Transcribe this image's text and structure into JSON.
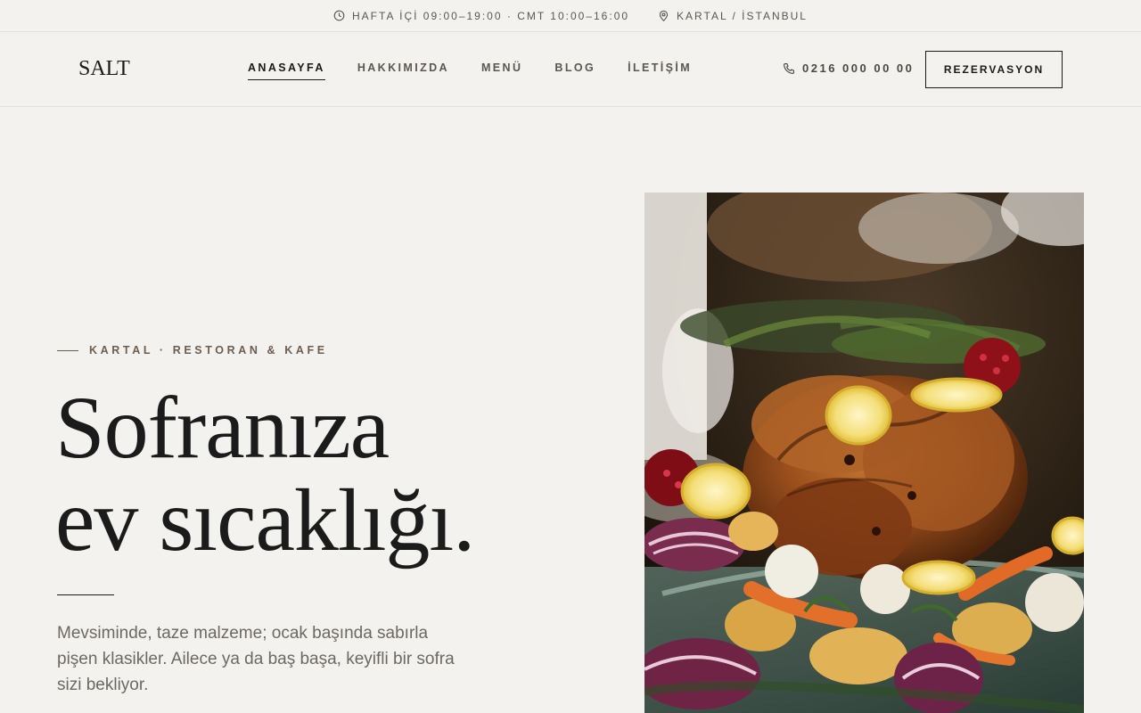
{
  "topbar": {
    "hours": "HAFTA İÇİ 09:00–19:00 · CMT 10:00–16:00",
    "location": "KARTAL / İSTANBUL",
    "hours_icon": "clock-icon",
    "location_icon": "map-pin-icon"
  },
  "header": {
    "logo": "SALT",
    "nav": [
      {
        "label": "ANASAYFA",
        "active": true
      },
      {
        "label": "HAKKIMIZDA",
        "active": false
      },
      {
        "label": "MENÜ",
        "active": false
      },
      {
        "label": "BLOG",
        "active": false
      },
      {
        "label": "İLETİŞİM",
        "active": false
      }
    ],
    "phone": "0216 000 00 00",
    "phone_icon": "phone-icon",
    "reservation_label": "REZERVASYON"
  },
  "hero": {
    "eyebrow": "KARTAL · RESTORAN & KAFE",
    "title_line1": "Sofranıza",
    "title_line2": "ev sıcaklığı.",
    "description": "Mevsiminde, taze malzeme; ocak başında sabırla pişen klasikler. Ailece ya da baş başa, keyifli bir sofra sizi bekliyor."
  },
  "colors": {
    "background": "#f4f2ee",
    "text": "#1b1b1b",
    "muted": "#6d6862",
    "accent": "#6b5e50"
  }
}
